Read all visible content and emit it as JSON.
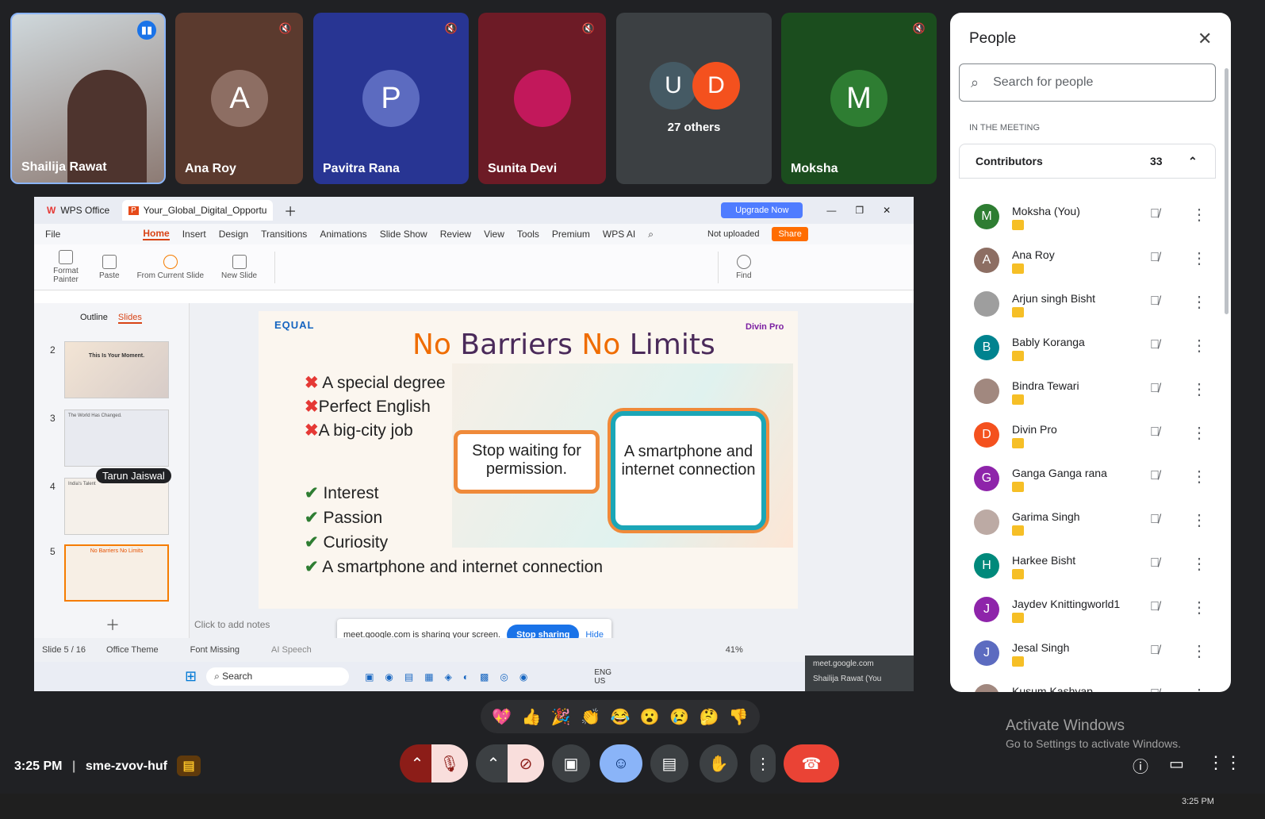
{
  "tiles": [
    {
      "name": "Shailija Rawat",
      "color": "#8fa3b0"
    },
    {
      "name": "Ana Roy",
      "initial": "A",
      "color": "#5b3a2e",
      "avatar_color": "#8d6e63"
    },
    {
      "name": "Pavitra Rana",
      "initial": "P",
      "color": "#283593",
      "avatar_color": "#5c6bc0"
    },
    {
      "name": "Sunita Devi",
      "color": "#6d1b26"
    },
    {
      "name": "27 others",
      "initials": [
        "U",
        "D"
      ],
      "color": "#3c4043"
    },
    {
      "name": "Moksha",
      "initial": "M",
      "color": "#1b4d1e",
      "avatar_color": "#2e7d32"
    }
  ],
  "wps": {
    "tabs": [
      "WPS Office",
      "Your_Global_Digital_Opportu"
    ],
    "upgrade": "Upgrade Now",
    "menu": [
      "File",
      "Home",
      "Insert",
      "Design",
      "Transitions",
      "Animations",
      "Slide Show",
      "Review",
      "View",
      "Tools",
      "Premium",
      "WPS AI"
    ],
    "not_uploaded": "Not uploaded",
    "share": "Share",
    "ribbon": {
      "format_painter": "Format Painter",
      "paste": "Paste",
      "from_current": "From Current Slide",
      "new_slide": "New Slide",
      "find": "Find"
    },
    "pane_tabs": [
      "Outline",
      "Slides"
    ],
    "thumbs": [
      {
        "num": "2",
        "text": "This Is Your Moment."
      },
      {
        "num": "3",
        "text": "The World Has Changed."
      },
      {
        "num": "4",
        "text": "India's Talent"
      },
      {
        "num": "5",
        "text": "No Barriers No Limits"
      }
    ],
    "tooltip": "Tarun Jaiswal",
    "status": {
      "slide": "Slide 5 / 16",
      "theme": "Office Theme",
      "font": "Font Missing",
      "zoom": "41%"
    },
    "notes": "Click to add notes",
    "speech": "AI Speech",
    "share_bar": {
      "text": "meet.google.com is sharing your screen.",
      "stop": "Stop sharing",
      "hide": "Hide"
    },
    "taskbar": {
      "search": "Search",
      "lang1": "ENG",
      "lang2": "US",
      "meet": "meet.google.com",
      "presenter": "Shailija Rawat (You"
    }
  },
  "slide": {
    "logo_left": "EQUAL",
    "logo_right": "Divin Pro",
    "title_no1": "No",
    "title_barriers": "Barriers",
    "title_no2": "No",
    "title_limits": "Limits",
    "crosses": [
      "A special degree",
      "Perfect English",
      "A big-city job"
    ],
    "checks": [
      "Interest",
      "Passion",
      "Curiosity",
      "A smartphone and internet connection"
    ],
    "box1": "Stop waiting for permission.",
    "box2": "A smartphone and internet connection"
  },
  "people": {
    "title": "People",
    "search_placeholder": "Search for people",
    "section": "IN THE MEETING",
    "group": "Contributors",
    "count": "33",
    "list": [
      {
        "name": "Moksha (You)",
        "initial": "M",
        "color": "#2e7d32"
      },
      {
        "name": "Ana Roy",
        "initial": "A",
        "color": "#8d6e63"
      },
      {
        "name": "Arjun singh Bisht",
        "initial": "",
        "color": "#9e9e9e"
      },
      {
        "name": "Bably Koranga",
        "initial": "B",
        "color": "#00838f"
      },
      {
        "name": "Bindra Tewari",
        "initial": "",
        "color": "#a1887f"
      },
      {
        "name": "Divin Pro",
        "initial": "D",
        "color": "#f4511e"
      },
      {
        "name": "Ganga Ganga rana",
        "initial": "G",
        "color": "#8e24aa"
      },
      {
        "name": "Garima Singh",
        "initial": "",
        "color": "#bcaaa4"
      },
      {
        "name": "Harkee Bisht",
        "initial": "H",
        "color": "#00897b"
      },
      {
        "name": "Jaydev Knittingworld1",
        "initial": "J",
        "color": "#8e24aa"
      },
      {
        "name": "Jesal Singh",
        "initial": "J",
        "color": "#5c6bc0"
      },
      {
        "name": "Kusum Kashyap",
        "initial": "",
        "color": "#a1887f"
      }
    ]
  },
  "bottom": {
    "time": "3:25 PM",
    "code": "sme-zvov-huf",
    "activate1": "Activate Windows",
    "activate2": "Go to Settings to activate Windows.",
    "clock": "3:25 PM"
  },
  "reactions": [
    "💖",
    "👍",
    "🎉",
    "👏",
    "😂",
    "😮",
    "😢",
    "🤔",
    "👎"
  ]
}
